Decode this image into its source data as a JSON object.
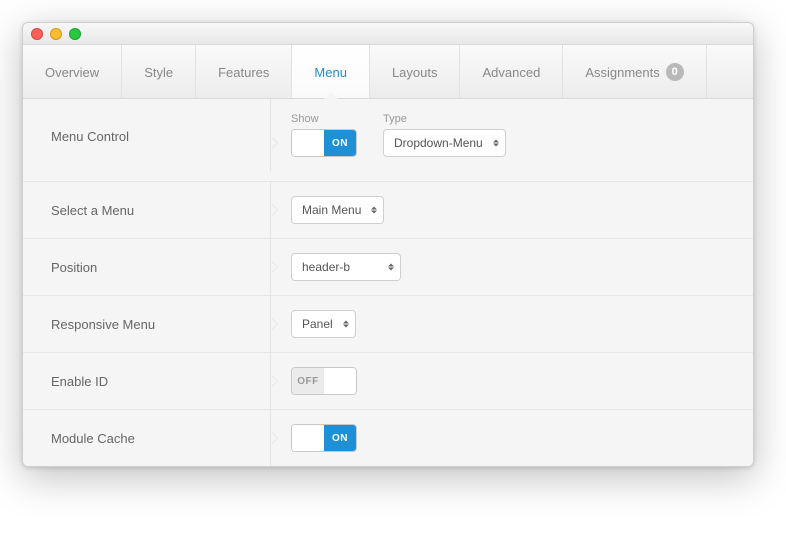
{
  "tabs": [
    {
      "label": "Overview",
      "active": false
    },
    {
      "label": "Style",
      "active": false
    },
    {
      "label": "Features",
      "active": false
    },
    {
      "label": "Menu",
      "active": true
    },
    {
      "label": "Layouts",
      "active": false
    },
    {
      "label": "Advanced",
      "active": false
    },
    {
      "label": "Assignments",
      "active": false,
      "badge": "0"
    }
  ],
  "rows": {
    "menu_control": {
      "label": "Menu Control",
      "show_label": "Show",
      "show_state": "ON",
      "type_label": "Type",
      "type_value": "Dropdown-Menu"
    },
    "select_menu": {
      "label": "Select a Menu",
      "value": "Main Menu"
    },
    "position": {
      "label": "Position",
      "value": "header-b"
    },
    "responsive": {
      "label": "Responsive Menu",
      "value": "Panel"
    },
    "enable_id": {
      "label": "Enable ID",
      "state": "OFF"
    },
    "module_cache": {
      "label": "Module Cache",
      "state": "ON"
    }
  },
  "toggle_text": {
    "on": "ON",
    "off": "OFF"
  }
}
